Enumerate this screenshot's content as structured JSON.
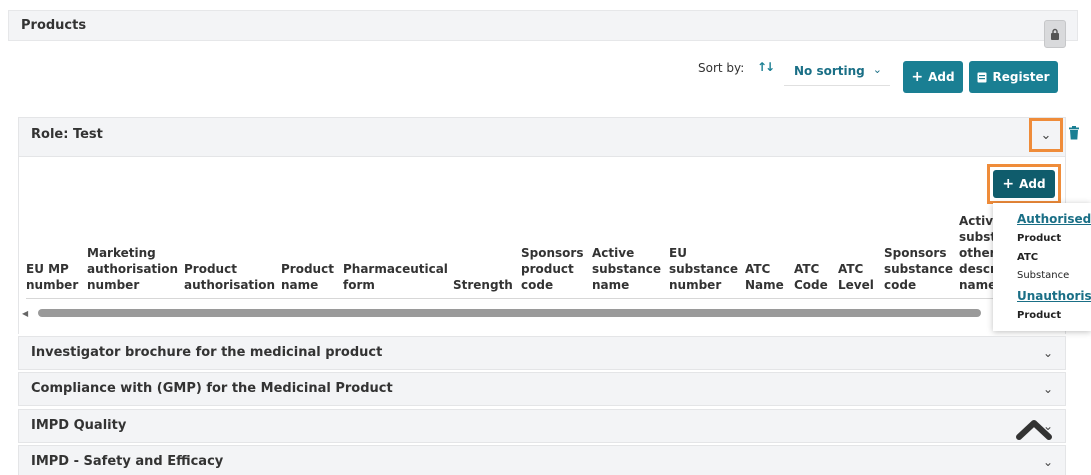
{
  "products": {
    "title": "Products",
    "lock_icon": "lock-icon"
  },
  "sort": {
    "label": "Sort by:",
    "icon": "sort-arrows-icon",
    "value": "No sorting"
  },
  "toolbar": {
    "add_label": "Add",
    "register_label": "Register"
  },
  "role": {
    "title": "Role: Test",
    "add_label": "Add"
  },
  "table": {
    "headers": [
      [
        "EU MP",
        "number"
      ],
      [
        "Marketing",
        "authorisation",
        "number"
      ],
      [
        "Product",
        "authorisation"
      ],
      [
        "Product",
        "name"
      ],
      [
        "Pharmaceutical",
        "form"
      ],
      [
        "Strength"
      ],
      [
        "Sponsors",
        "product",
        "code"
      ],
      [
        "Active",
        "substance",
        "name"
      ],
      [
        "EU",
        "substance",
        "number"
      ],
      [
        "ATC",
        "Name"
      ],
      [
        "ATC",
        "Code"
      ],
      [
        "ATC",
        "Level"
      ],
      [
        "Sponsors",
        "substance",
        "code"
      ],
      [
        "Activ",
        "subst",
        "other",
        "descr",
        "name"
      ]
    ]
  },
  "dropdown": {
    "authorised_label": "Authorised",
    "authorised_items": [
      "Product",
      "ATC",
      "Substance"
    ],
    "unauthorised_label": "Unauthorise",
    "unauthorised_items": [
      "Product"
    ]
  },
  "sections": [
    "Investigator brochure for the medicinal product",
    "Compliance with (GMP) for the Medicinal Product",
    "IMPD Quality",
    "IMPD - Safety and Efficacy"
  ],
  "colors": {
    "accent": "#1a7f93",
    "accent_dark": "#0f5c6c",
    "highlight": "#ef8c3a"
  }
}
